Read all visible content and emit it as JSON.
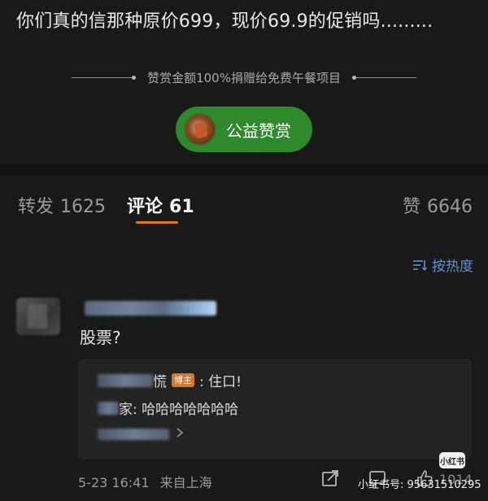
{
  "post": {
    "text": "你们真的信那种原价699，现价69.9的促销吗........."
  },
  "donation": {
    "note": "赞赏金额100%捐赠给免费午餐项目",
    "button_label": "公益赞赏"
  },
  "tabs": [
    {
      "label": "转发",
      "count": "1625"
    },
    {
      "label": "评论",
      "count": "61"
    },
    {
      "label": "赞",
      "count": "6646"
    }
  ],
  "sort": {
    "label": "按热度"
  },
  "comment": {
    "text": "股票?",
    "replies": [
      {
        "name_visible": "慌",
        "badge": "博主",
        "text": ": 住口!"
      },
      {
        "name_visible": "家",
        "text": ": 哈哈哈哈哈哈哈"
      }
    ],
    "more_icon": "chevron-right-icon",
    "timestamp": "5-23 16:41",
    "location": "来自上海",
    "icons": [
      "share-icon",
      "comment-icon",
      "like-icon"
    ],
    "like_count": "1014"
  },
  "watermark": {
    "logo_text": "小红书",
    "label": "小红书号:",
    "id": "95631510295"
  },
  "colors": {
    "background": "#191919",
    "reward_green": "#2f8a2c",
    "tab_underline": "#e07a1f",
    "sort_blue": "#5d8fd6",
    "author_badge": "#d8762a"
  }
}
